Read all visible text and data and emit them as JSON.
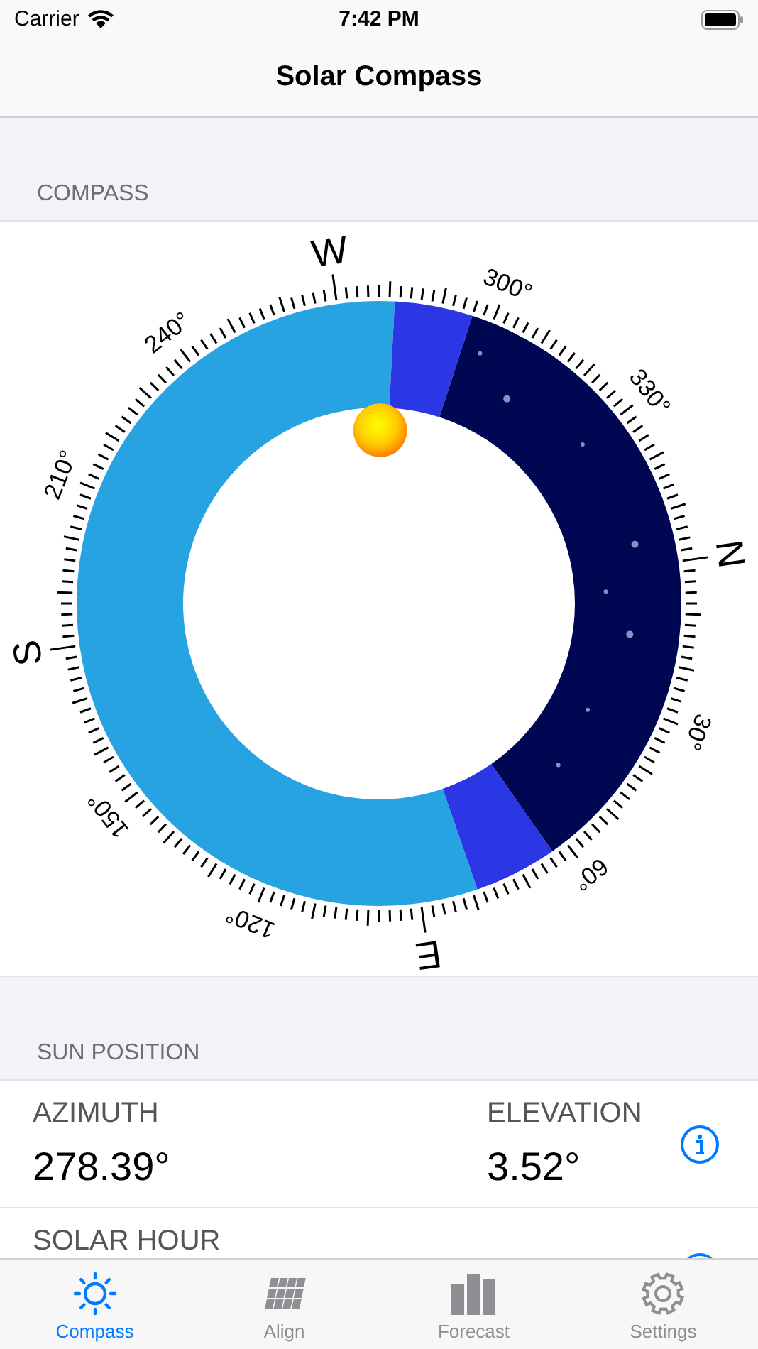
{
  "status_bar": {
    "carrier": "Carrier",
    "time": "7:42 PM"
  },
  "nav": {
    "title": "Solar Compass"
  },
  "compass": {
    "header": "COMPASS",
    "labels": [
      {
        "text": "N",
        "kind": "cardinal"
      },
      {
        "text": "30°",
        "kind": "degree"
      },
      {
        "text": "60°",
        "kind": "degree"
      },
      {
        "text": "E",
        "kind": "cardinal"
      },
      {
        "text": "120°",
        "kind": "degree"
      },
      {
        "text": "150°",
        "kind": "degree"
      },
      {
        "text": "S",
        "kind": "cardinal"
      },
      {
        "text": "210°",
        "kind": "degree"
      },
      {
        "text": "240°",
        "kind": "degree"
      },
      {
        "text": "W",
        "kind": "cardinal"
      },
      {
        "text": "300°",
        "kind": "degree"
      },
      {
        "text": "330°",
        "kind": "degree"
      }
    ]
  },
  "sun_position": {
    "header": "SUN POSITION",
    "rows": [
      {
        "fields": [
          {
            "label": "AZIMUTH",
            "value": "278.39°"
          },
          {
            "label": "ELEVATION",
            "value": "3.52°"
          }
        ]
      },
      {
        "fields": [
          {
            "label": "SOLAR HOUR"
          }
        ]
      }
    ]
  },
  "tabs": [
    {
      "label": "Compass",
      "kind": "sun",
      "selected": true
    },
    {
      "label": "Align",
      "kind": "panels",
      "selected": false
    },
    {
      "label": "Forecast",
      "kind": "bars",
      "selected": false
    },
    {
      "label": "Settings",
      "kind": "gear",
      "selected": false
    }
  ]
}
